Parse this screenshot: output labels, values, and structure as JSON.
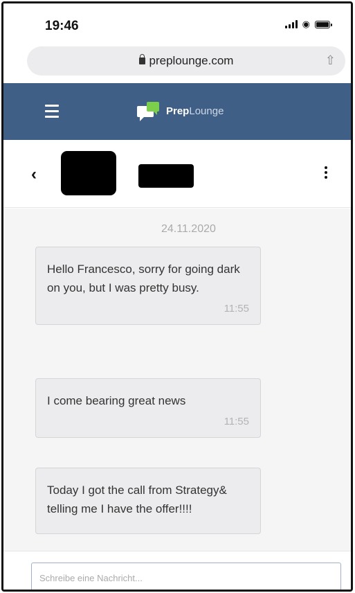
{
  "status_bar": {
    "time": "19:46"
  },
  "browser": {
    "url": "preplounge.com"
  },
  "app_header": {
    "logo_bold": "Prep",
    "logo_light": "Lounge"
  },
  "conversation": {
    "date_separator": "24.11.2020",
    "messages": [
      {
        "text": "Hello Francesco, sorry for going dark on you, but I was pretty busy.",
        "time": "11:55"
      },
      {
        "text": "I come bearing great news",
        "time": "11:55"
      },
      {
        "text": "Today I got the call from Strategy& telling me I have the offer!!!!",
        "time": ""
      }
    ]
  },
  "composer": {
    "placeholder": "Schreibe eine Nachricht..."
  },
  "icons": {
    "back": "chevron-left-icon",
    "menu": "hamburger-icon",
    "more": "vertical-dots-icon",
    "share": "share-icon",
    "lock": "lock-icon"
  },
  "colors": {
    "header_bg": "#3f5f86",
    "logo_green": "#7ccf4a"
  }
}
